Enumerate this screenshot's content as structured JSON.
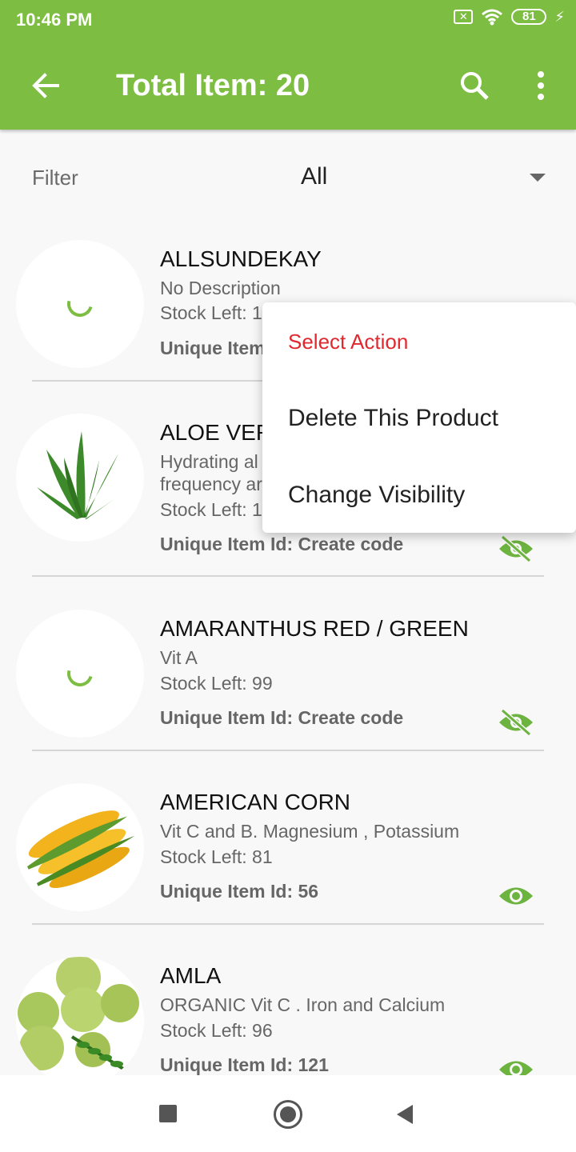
{
  "status_bar": {
    "time": "10:46 PM",
    "sim_badge": "✕",
    "battery_level": "81",
    "charging_icon": "⚡"
  },
  "app_bar": {
    "title": "Total Item: 20",
    "back_icon": "arrow-left",
    "search_icon": "search",
    "menu_icon": "more-vert"
  },
  "filter": {
    "label": "Filter",
    "value": "All"
  },
  "items": [
    {
      "name": "ALLSUNDEKAY",
      "description": "No Description",
      "stock": "Stock Left: 1",
      "unique_id": "Unique Item",
      "image": "loading-spinner"
    },
    {
      "name": "ALOE VER",
      "description": "Hydrating al\nfrequency ar",
      "stock": "Stock Left: 1",
      "unique_id": "Unique Item Id: Create code",
      "image": "aloe-vera",
      "visible": false
    },
    {
      "name": "AMARANTHUS  RED  / GREEN",
      "description": "Vit A",
      "stock": "Stock Left: 99",
      "unique_id": "Unique Item Id: Create code",
      "image": "loading-spinner",
      "visible": false
    },
    {
      "name": "AMERICAN CORN",
      "description": "Vit C and B. Magnesium ,  Potassium",
      "stock": "Stock Left: 81",
      "unique_id": "Unique Item Id: 56",
      "image": "corn",
      "visible": true
    },
    {
      "name": "AMLA",
      "description": "ORGANIC Vit C  .  Iron and Calcium",
      "stock": "Stock Left: 96",
      "unique_id": "Unique Item Id: 121",
      "image": "amla",
      "visible": true
    }
  ],
  "popup": {
    "title": "Select Action",
    "options": [
      "Delete This Product",
      "Change Visibility"
    ]
  },
  "colors": {
    "primary": "#7cbd42",
    "accent_red": "#e0282e",
    "eye_green": "#6db33f"
  },
  "nav_bar": {
    "icons": [
      "recents-square",
      "home-circle",
      "back-triangle"
    ]
  }
}
